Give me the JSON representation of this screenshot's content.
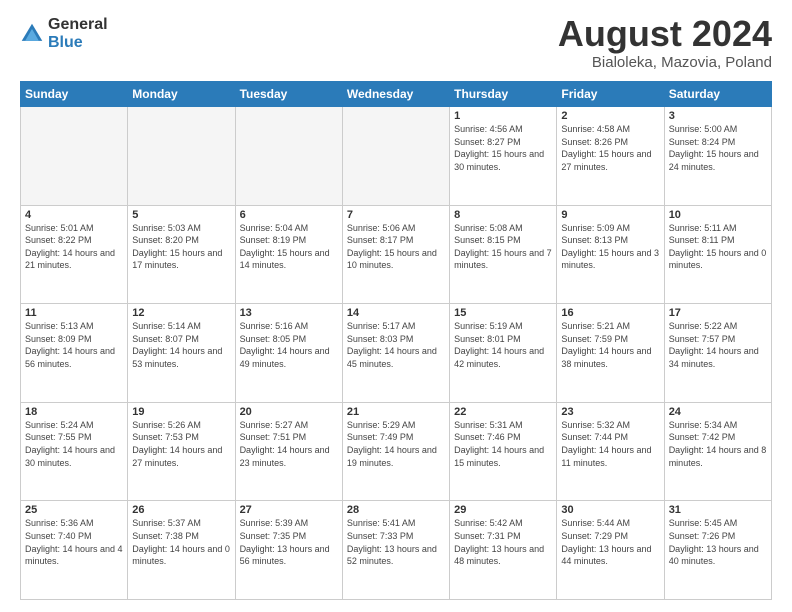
{
  "header": {
    "logo_general": "General",
    "logo_blue": "Blue",
    "month_year": "August 2024",
    "location": "Bialoleka, Mazovia, Poland"
  },
  "days_of_week": [
    "Sunday",
    "Monday",
    "Tuesday",
    "Wednesday",
    "Thursday",
    "Friday",
    "Saturday"
  ],
  "weeks": [
    [
      {
        "day": "",
        "empty": true
      },
      {
        "day": "",
        "empty": true
      },
      {
        "day": "",
        "empty": true
      },
      {
        "day": "",
        "empty": true
      },
      {
        "day": "1",
        "sunrise": "4:56 AM",
        "sunset": "8:27 PM",
        "daylight": "15 hours and 30 minutes."
      },
      {
        "day": "2",
        "sunrise": "4:58 AM",
        "sunset": "8:26 PM",
        "daylight": "15 hours and 27 minutes."
      },
      {
        "day": "3",
        "sunrise": "5:00 AM",
        "sunset": "8:24 PM",
        "daylight": "15 hours and 24 minutes."
      }
    ],
    [
      {
        "day": "4",
        "sunrise": "5:01 AM",
        "sunset": "8:22 PM",
        "daylight": "14 hours and 21 minutes."
      },
      {
        "day": "5",
        "sunrise": "5:03 AM",
        "sunset": "8:20 PM",
        "daylight": "15 hours and 17 minutes."
      },
      {
        "day": "6",
        "sunrise": "5:04 AM",
        "sunset": "8:19 PM",
        "daylight": "15 hours and 14 minutes."
      },
      {
        "day": "7",
        "sunrise": "5:06 AM",
        "sunset": "8:17 PM",
        "daylight": "15 hours and 10 minutes."
      },
      {
        "day": "8",
        "sunrise": "5:08 AM",
        "sunset": "8:15 PM",
        "daylight": "15 hours and 7 minutes."
      },
      {
        "day": "9",
        "sunrise": "5:09 AM",
        "sunset": "8:13 PM",
        "daylight": "15 hours and 3 minutes."
      },
      {
        "day": "10",
        "sunrise": "5:11 AM",
        "sunset": "8:11 PM",
        "daylight": "15 hours and 0 minutes."
      }
    ],
    [
      {
        "day": "11",
        "sunrise": "5:13 AM",
        "sunset": "8:09 PM",
        "daylight": "14 hours and 56 minutes."
      },
      {
        "day": "12",
        "sunrise": "5:14 AM",
        "sunset": "8:07 PM",
        "daylight": "14 hours and 53 minutes."
      },
      {
        "day": "13",
        "sunrise": "5:16 AM",
        "sunset": "8:05 PM",
        "daylight": "14 hours and 49 minutes."
      },
      {
        "day": "14",
        "sunrise": "5:17 AM",
        "sunset": "8:03 PM",
        "daylight": "14 hours and 45 minutes."
      },
      {
        "day": "15",
        "sunrise": "5:19 AM",
        "sunset": "8:01 PM",
        "daylight": "14 hours and 42 minutes."
      },
      {
        "day": "16",
        "sunrise": "5:21 AM",
        "sunset": "7:59 PM",
        "daylight": "14 hours and 38 minutes."
      },
      {
        "day": "17",
        "sunrise": "5:22 AM",
        "sunset": "7:57 PM",
        "daylight": "14 hours and 34 minutes."
      }
    ],
    [
      {
        "day": "18",
        "sunrise": "5:24 AM",
        "sunset": "7:55 PM",
        "daylight": "14 hours and 30 minutes."
      },
      {
        "day": "19",
        "sunrise": "5:26 AM",
        "sunset": "7:53 PM",
        "daylight": "14 hours and 27 minutes."
      },
      {
        "day": "20",
        "sunrise": "5:27 AM",
        "sunset": "7:51 PM",
        "daylight": "14 hours and 23 minutes."
      },
      {
        "day": "21",
        "sunrise": "5:29 AM",
        "sunset": "7:49 PM",
        "daylight": "14 hours and 19 minutes."
      },
      {
        "day": "22",
        "sunrise": "5:31 AM",
        "sunset": "7:46 PM",
        "daylight": "14 hours and 15 minutes."
      },
      {
        "day": "23",
        "sunrise": "5:32 AM",
        "sunset": "7:44 PM",
        "daylight": "14 hours and 11 minutes."
      },
      {
        "day": "24",
        "sunrise": "5:34 AM",
        "sunset": "7:42 PM",
        "daylight": "14 hours and 8 minutes."
      }
    ],
    [
      {
        "day": "25",
        "sunrise": "5:36 AM",
        "sunset": "7:40 PM",
        "daylight": "14 hours and 4 minutes."
      },
      {
        "day": "26",
        "sunrise": "5:37 AM",
        "sunset": "7:38 PM",
        "daylight": "14 hours and 0 minutes."
      },
      {
        "day": "27",
        "sunrise": "5:39 AM",
        "sunset": "7:35 PM",
        "daylight": "13 hours and 56 minutes."
      },
      {
        "day": "28",
        "sunrise": "5:41 AM",
        "sunset": "7:33 PM",
        "daylight": "13 hours and 52 minutes."
      },
      {
        "day": "29",
        "sunrise": "5:42 AM",
        "sunset": "7:31 PM",
        "daylight": "13 hours and 48 minutes."
      },
      {
        "day": "30",
        "sunrise": "5:44 AM",
        "sunset": "7:29 PM",
        "daylight": "13 hours and 44 minutes."
      },
      {
        "day": "31",
        "sunrise": "5:45 AM",
        "sunset": "7:26 PM",
        "daylight": "13 hours and 40 minutes."
      }
    ]
  ]
}
